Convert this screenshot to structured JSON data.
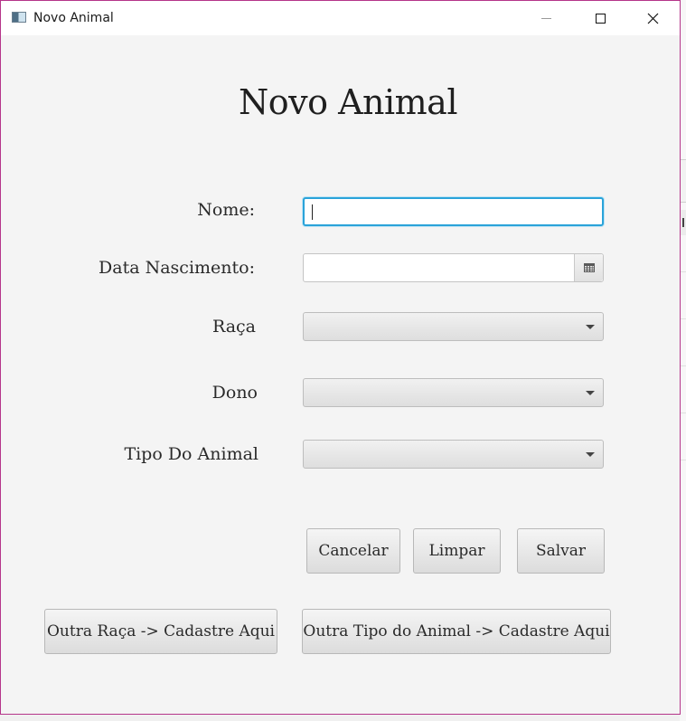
{
  "window": {
    "title": "Novo Animal"
  },
  "form": {
    "heading": "Novo Animal",
    "nome_label": "Nome:",
    "nome_value": "",
    "data_label": "Data Nascimento:",
    "data_value": "",
    "raca_label": "Raça",
    "raca_value": "",
    "dono_label": "Dono",
    "dono_value": "",
    "tipo_label": "Tipo Do Animal",
    "tipo_value": ""
  },
  "actions": {
    "cancelar": "Cancelar",
    "limpar": "Limpar",
    "salvar": "Salvar",
    "outra_raca": "Outra Raça -> Cadastre Aqui",
    "outro_tipo": "Outra Tipo do Animal -> Cadastre Aqui"
  },
  "icons": {
    "app": "app-window-icon",
    "calendar": "calendar-icon",
    "dropdown": "chevron-down-icon"
  },
  "colors": {
    "focus_border": "#2aa3d9",
    "window_border": "#b5358a",
    "background": "#f4f4f4"
  }
}
